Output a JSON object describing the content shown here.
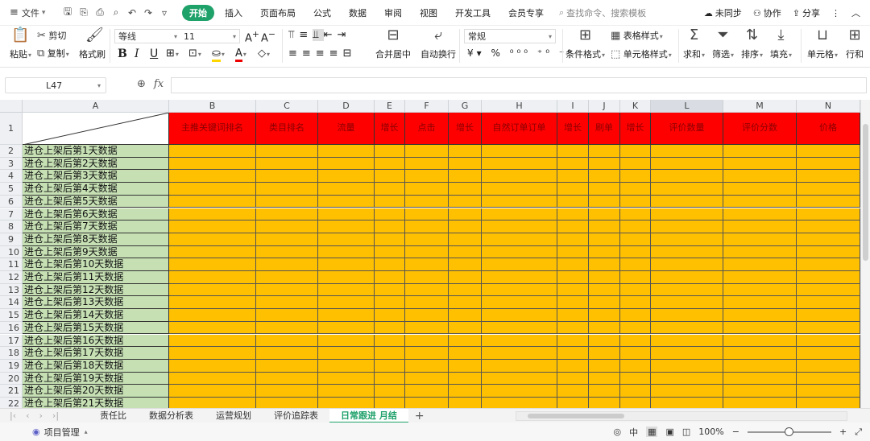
{
  "menubar": {
    "file_label": "文件",
    "tabs": [
      "开始",
      "插入",
      "页面布局",
      "公式",
      "数据",
      "审阅",
      "视图",
      "开发工具",
      "会员专享"
    ],
    "active_tab": "开始",
    "search_placeholder": "查找命令、搜索模板",
    "sync_label": "未同步",
    "collab_label": "协作",
    "share_label": "分享"
  },
  "ribbon": {
    "paste": "粘贴",
    "cut": "剪切",
    "copy": "复制",
    "format_painter": "格式刷",
    "font_name": "等线",
    "font_size": "11",
    "merge_center": "合并居中",
    "auto_wrap": "自动换行",
    "number_format": "常规",
    "conditional_format": "条件格式",
    "table_style": "表格样式",
    "cell_style": "单元格样式",
    "sum": "求和",
    "filter": "筛选",
    "sort": "排序",
    "fill": "填充",
    "cell": "单元格",
    "row_col": "行和"
  },
  "formula_bar": {
    "cell_ref": "L47",
    "formula": ""
  },
  "columns": [
    {
      "letter": "A",
      "selected": false
    },
    {
      "letter": "B",
      "selected": false
    },
    {
      "letter": "C",
      "selected": false
    },
    {
      "letter": "D",
      "selected": false
    },
    {
      "letter": "E",
      "selected": false
    },
    {
      "letter": "F",
      "selected": false
    },
    {
      "letter": "G",
      "selected": false
    },
    {
      "letter": "H",
      "selected": false
    },
    {
      "letter": "I",
      "selected": false
    },
    {
      "letter": "J",
      "selected": false
    },
    {
      "letter": "K",
      "selected": false
    },
    {
      "letter": "L",
      "selected": true
    },
    {
      "letter": "M",
      "selected": false
    },
    {
      "letter": "N",
      "selected": false
    }
  ],
  "header_row": [
    "",
    "主推关键词排名",
    "类目排名",
    "流量",
    "增长",
    "点击",
    "增长",
    "自然订单订单",
    "增长",
    "刷单",
    "增长",
    "评价数量",
    "评价分数",
    "价格"
  ],
  "rows": [
    "进仓上架后第1天数据",
    "进仓上架后第2天数据",
    "进仓上架后第3天数据",
    "进仓上架后第4天数据",
    "进仓上架后第5天数据",
    "进仓上架后第6天数据",
    "进仓上架后第7天数据",
    "进仓上架后第8天数据",
    "进仓上架后第9天数据",
    "进仓上架后第10天数据",
    "进仓上架后第11天数据",
    "进仓上架后第12天数据",
    "进仓上架后第13天数据",
    "进仓上架后第14天数据",
    "进仓上架后第15天数据",
    "进仓上架后第16天数据",
    "进仓上架后第17天数据",
    "进仓上架后第18天数据",
    "进仓上架后第19天数据",
    "进仓上架后第20天数据",
    "进仓上架后第21天数据"
  ],
  "row_numbers": [
    "1",
    "2",
    "3",
    "4",
    "5",
    "6",
    "7",
    "8",
    "9",
    "10",
    "11",
    "12",
    "13",
    "14",
    "15",
    "16",
    "17",
    "18",
    "19",
    "20",
    "21",
    "22"
  ],
  "sheets": [
    "责任比",
    "数据分析表",
    "运营规划",
    "评价追踪表",
    "日常跟进 月结"
  ],
  "active_sheet": "日常跟进 月结",
  "status": {
    "project": "项目管理",
    "lang": "中",
    "zoom": "100%",
    "zoom_fraction": 0.5
  },
  "colors": {
    "header_fill": "#ff0000",
    "first_col_fill": "#c6e0b4",
    "data_fill": "#ffc000",
    "accent": "#1fa16a"
  }
}
